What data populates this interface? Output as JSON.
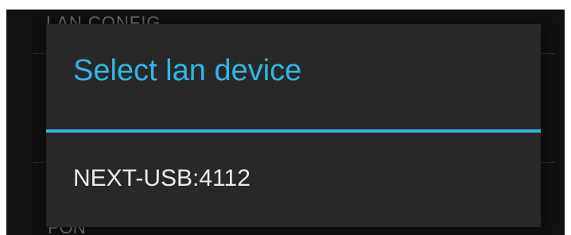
{
  "background": {
    "header_text": "LAN CONFIG",
    "footer_text": "PON"
  },
  "dialog": {
    "title": "Select lan device",
    "items": [
      {
        "label": "NEXT-USB:4112"
      }
    ]
  },
  "colors": {
    "accent": "#33b5e5",
    "dialog_background": "#282828",
    "screen_background": "#111111",
    "item_text": "#ececec"
  }
}
